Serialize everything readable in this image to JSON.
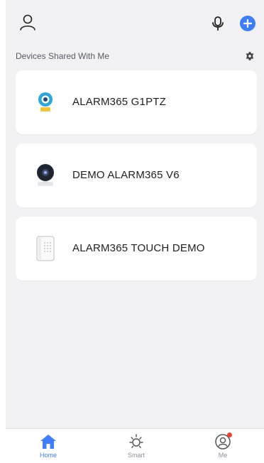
{
  "header": {
    "profile_icon": "person-icon",
    "mic_icon": "microphone-icon",
    "add_icon": "plus-icon"
  },
  "section": {
    "title": "Devices Shared With Me",
    "settings_icon": "gear-icon"
  },
  "devices": [
    {
      "name": "ALARM365 G1PTZ",
      "thumb": "ptz-camera"
    },
    {
      "name": "DEMO ALARM365 V6",
      "thumb": "indoor-camera"
    },
    {
      "name": "ALARM365 TOUCH DEMO",
      "thumb": "touch-keypad"
    }
  ],
  "tabbar": {
    "tabs": [
      {
        "label": "Home",
        "icon": "home-icon",
        "active": true
      },
      {
        "label": "Smart",
        "icon": "sun-icon",
        "active": false
      },
      {
        "label": "Me",
        "icon": "user-circle-icon",
        "active": false,
        "badge": true
      }
    ]
  },
  "colors": {
    "accent": "#3e7ef7",
    "background": "#f2f2f5",
    "card": "#ffffff",
    "badge": "#e8433a"
  }
}
